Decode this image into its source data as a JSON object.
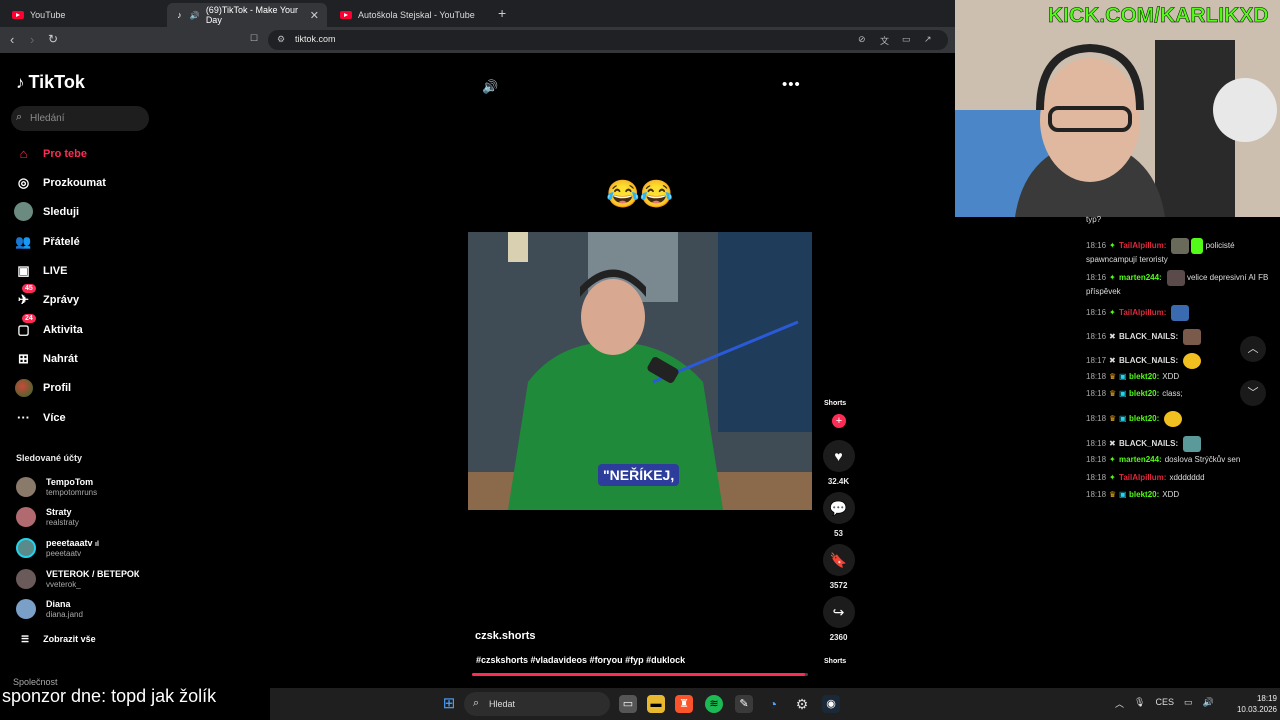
{
  "browser": {
    "tabs": [
      {
        "label": "YouTube",
        "icon": "youtube-icon"
      },
      {
        "label": "(69)TikTok - Make Your Day",
        "icon": "tiktok-icon",
        "active": true
      },
      {
        "label": "Autoškola Stejskal - YouTube",
        "icon": "youtube-icon"
      }
    ],
    "new_tab": "+",
    "url": "tiktok.com"
  },
  "sidebar": {
    "logo": "TikTok",
    "search_placeholder": "Hledání",
    "nav": [
      {
        "label": "Pro tebe",
        "icon": "home-icon",
        "active": true
      },
      {
        "label": "Prozkoumat",
        "icon": "compass-icon"
      },
      {
        "label": "Sleduji",
        "icon": "following-icon"
      },
      {
        "label": "Přátelé",
        "icon": "friends-icon"
      },
      {
        "label": "LIVE",
        "icon": "live-icon"
      },
      {
        "label": "Zprávy",
        "icon": "messages-icon",
        "badge": "45"
      },
      {
        "label": "Aktivita",
        "icon": "activity-icon",
        "badge": "24"
      },
      {
        "label": "Nahrát",
        "icon": "upload-icon"
      },
      {
        "label": "Profil",
        "icon": "profile-icon"
      },
      {
        "label": "Více",
        "icon": "more-icon"
      }
    ],
    "followed_title": "Sledované účty",
    "followed": [
      {
        "name": "TempoTom",
        "handle": "tempotomruns"
      },
      {
        "name": "Straty",
        "handle": "realstraty"
      },
      {
        "name": "peeetaaatv",
        "handle": "peeetaatv",
        "live_tag": "ıl"
      },
      {
        "name": "VETEROK / ВЕТЕРОК",
        "handle": "vveterok_"
      },
      {
        "name": "Diana",
        "handle": "diana.jand"
      }
    ],
    "show_all": "Zobrazit vše",
    "company": "Společnost"
  },
  "video": {
    "emojis": "😂😂",
    "caption_overlay": "\"NEŘÍKEJ,",
    "author": "czsk.shorts",
    "hashtags": "#czskshorts #vladavideos #foryou #fyp #duklock",
    "progress": 0.99,
    "shorts_label": "Shorts",
    "actions": [
      {
        "name": "like",
        "icon": "heart-icon",
        "count": "32.4K"
      },
      {
        "name": "comment",
        "icon": "comment-icon",
        "count": "53"
      },
      {
        "name": "save",
        "icon": "bookmark-icon",
        "count": "3572"
      },
      {
        "name": "share",
        "icon": "share-icon",
        "count": "2360"
      }
    ]
  },
  "overlay": {
    "kick_banner": "KICK.COM/KARLIKXD",
    "sponsor": "sponzor dne: topd jak žolík"
  },
  "chat": {
    "top_fragment": "typ?",
    "messages": [
      {
        "time": "18:16",
        "user": "TailAlpillum:",
        "user_color": "#e0283c",
        "text": "policisté spawncampují teroristy"
      },
      {
        "time": "18:16",
        "user": "marten244:",
        "user_color": "#53fc18",
        "text": "velice depresivní AI FB příspěvek"
      },
      {
        "time": "18:16",
        "user": "TailAlpillum:",
        "user_color": "#e0283c",
        "text": ""
      },
      {
        "time": "18:16",
        "user": "BLACK_NAILS:",
        "user_color": "#dddddd",
        "text": ""
      },
      {
        "time": "18:17",
        "user": "BLACK_NAILS:",
        "user_color": "#dddddd",
        "text": ""
      },
      {
        "time": "18:18",
        "user": "blekt20:",
        "user_color": "#53fc18",
        "text": "XDD"
      },
      {
        "time": "18:18",
        "user": "blekt20:",
        "user_color": "#53fc18",
        "text": "class;"
      },
      {
        "time": "18:18",
        "user": "blekt20:",
        "user_color": "#53fc18",
        "text": ""
      },
      {
        "time": "18:18",
        "user": "BLACK_NAILS:",
        "user_color": "#dddddd",
        "text": ""
      },
      {
        "time": "18:18",
        "user": "marten244:",
        "user_color": "#53fc18",
        "text": "doslova Strýčkův sen"
      },
      {
        "time": "18:18",
        "user": "TailAlpillum:",
        "user_color": "#e0283c",
        "text": "xddddddd"
      },
      {
        "time": "18:18",
        "user": "blekt20:",
        "user_color": "#53fc18",
        "text": "XDD"
      }
    ]
  },
  "taskbar": {
    "search_label": "Hledat",
    "lang": "CES",
    "time": "18:19",
    "date": "10.03.2026"
  }
}
